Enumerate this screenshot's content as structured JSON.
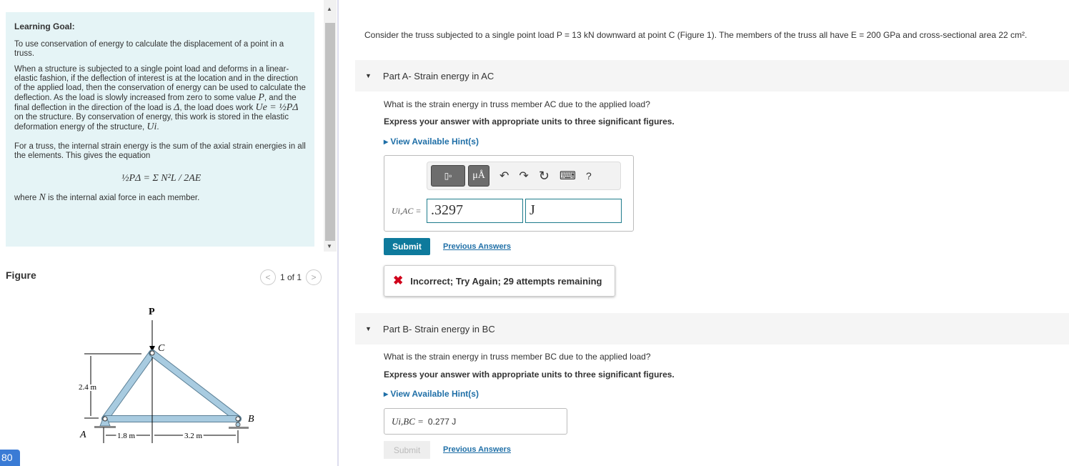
{
  "goal": {
    "title": "Learning Goal:",
    "p1": "To use conservation of energy to calculate the displacement of a point in a truss.",
    "p2a": "When a structure is subjected to a single point load and deforms in a linear-elastic fashion, if the deflection of interest is at the location and in the direction of the applied load, then the conservation of energy can be used to calculate the deflection. As the load is slowly increased from zero to some value ",
    "P": "P",
    "p2b": ", and the final deflection in the direction of the load is ",
    "Delta": "Δ",
    "p2c": ", the load does work ",
    "Ue": "Ue = ½PΔ",
    "p2d": " on the structure. By conservation of energy, this work is stored in the elastic deformation energy of the structure, ",
    "Ui": "Ui",
    "p3": "For a truss, the internal strain energy is the sum of the axial strain energies in all the elements. This gives the equation",
    "equation": "½PΔ = Σ N²L / 2AE",
    "p4a": "where ",
    "N": "N",
    "p4b": " is the internal axial force in each member."
  },
  "figure": {
    "label": "Figure",
    "pager": "1 of 1",
    "labels": {
      "P": "P",
      "A": "A",
      "B": "B",
      "C": "C",
      "h": "2.4 m",
      "d1": "1.8 m",
      "d2": "3.2 m"
    }
  },
  "badge": "80",
  "intro": "Consider the truss subjected to a single point load P = 13 kN downward at point C (Figure 1). The members of the truss all have E = 200 GPa and cross-sectional area 22 cm².",
  "partA": {
    "title": "Part A",
    "sub": " - Strain energy in AC",
    "question": "What is the strain energy in truss member AC due to the applied load?",
    "instruction": "Express your answer with appropriate units to three significant figures.",
    "hint": "▸ View Available Hint(s)",
    "label": "Ui,AC =",
    "value": ".3297",
    "unit": "J",
    "submit": "Submit",
    "previous": "Previous Answers",
    "error": "Incorrect; Try Again; 29 attempts remaining",
    "toolbar": {
      "templates": "▯▫",
      "units": "μÅ",
      "undo": "↶",
      "redo": "↷",
      "reset": "↻",
      "keyboard": "⌨",
      "help": "?"
    }
  },
  "partB": {
    "title": "Part B",
    "sub": " - Strain energy in BC",
    "question": "What is the strain energy in truss member BC due to the applied load?",
    "instruction": "Express your answer with appropriate units to three significant figures.",
    "hint": "▸ View Available Hint(s)",
    "answer_label": "Ui,BC =",
    "answer": "0.277 J",
    "submit": "Submit",
    "previous": "Previous Answers"
  }
}
